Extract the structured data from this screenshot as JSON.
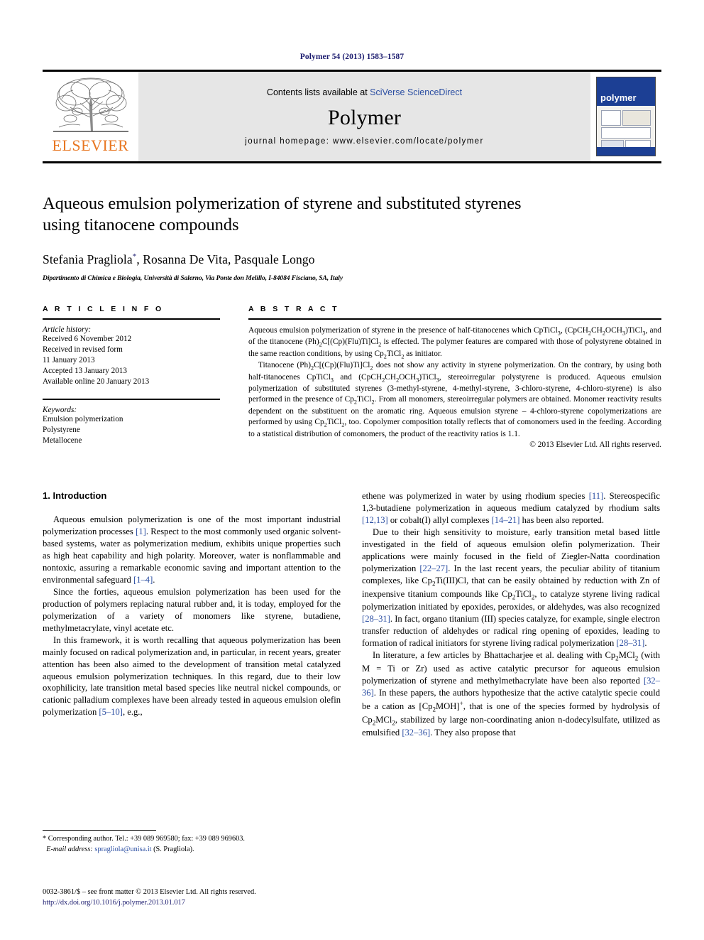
{
  "running_head": "Polymer 54 (2013) 1583–1587",
  "masthead": {
    "publisher_name": "ELSEVIER",
    "contents_prefix": "Contents lists available at ",
    "contents_link": "SciVerse ScienceDirect",
    "journal_name": "Polymer",
    "homepage": "journal homepage: www.elsevier.com/locate/polymer",
    "cover_title": "polymer"
  },
  "article": {
    "title_line1": "Aqueous emulsion polymerization of styrene and substituted styrenes",
    "title_line2": "using titanocene compounds",
    "authors": "Stefania Pragliola*, Rosanna De Vita, Pasquale Longo",
    "affiliation": "Dipartimento di Chimica e Biologia, Università di Salerno, Via Ponte don Melillo, I-84084 Fisciano, SA, Italy"
  },
  "info": {
    "heading": "A R T I C L E  I N F O",
    "history_label": "Article history:",
    "history": [
      "Received 6 November 2012",
      "Received in revised form",
      "11 January 2013",
      "Accepted 13 January 2013",
      "Available online 20 January 2013"
    ],
    "keywords_label": "Keywords:",
    "keywords": [
      "Emulsion polymerization",
      "Polystyrene",
      "Metallocene"
    ]
  },
  "abstract": {
    "heading": "A B S T R A C T",
    "paragraph1": "Aqueous emulsion polymerization of styrene in the presence of half-titanocenes which CpTiCl3, (CpCH2CH2OCH3)TiCl3, and of the titanocene (Ph)2C[(Cp)(Flu)Ti]Cl2 is effected. The polymer features are compared with those of polystyrene obtained in the same reaction conditions, by using Cp2TiCl2 as initiator.",
    "paragraph2": "Titanocene (Ph)2C[(Cp)(Flu)Ti]Cl2 does not show any activity in styrene polymerization. On the contrary, by using both half-titanocenes CpTiCl3 and (CpCH2CH2OCH3)TiCl3, stereoirregular polystyrene is produced. Aqueous emulsion polymerization of substituted styrenes (3-methyl-styrene, 4-methyl-styrene, 3-chloro-styrene, 4-chloro-styrene) is also performed in the presence of Cp2TiCl2. From all monomers, stereoirregular polymers are obtained. Monomer reactivity results dependent on the substituent on the aromatic ring. Aqueous emulsion styrene – 4-chloro-styrene copolymerizations are performed by using Cp2TiCl2, too. Copolymer composition totally reflects that of comonomers used in the feeding. According to a statistical distribution of comonomers, the product of the reactivity ratios is 1.1.",
    "copyright": "© 2013 Elsevier Ltd. All rights reserved."
  },
  "introduction": {
    "heading": "1. Introduction",
    "left_paragraphs": [
      "Aqueous emulsion polymerization is one of the most important industrial polymerization processes [1]. Respect to the most commonly used organic solvent-based systems, water as polymerization medium, exhibits unique properties such as high heat capability and high polarity. Moreover, water is nonflammable and nontoxic, assuring a remarkable economic saving and important attention to the environmental safeguard [1–4].",
      "Since the forties, aqueous emulsion polymerization has been used for the production of polymers replacing natural rubber and, it is today, employed for the polymerization of a variety of monomers like styrene, butadiene, methylmetacrylate, vinyl acetate etc.",
      "In this framework, it is worth recalling that aqueous polymerization has been mainly focused on radical polymerization and, in particular, in recent years, greater attention has been also aimed to the development of transition metal catalyzed aqueous emulsion polymerization techniques. In this regard, due to their low oxophilicity, late transition metal based species like neutral nickel compounds, or cationic palladium complexes have been already tested in aqueous emulsion olefin polymerization [5–10], e.g.,"
    ],
    "right_paragraphs": [
      "ethene was polymerized in water by using rhodium species [11]. Stereospecific 1,3-butadiene polymerization in aqueous medium catalyzed by rhodium salts [12,13] or cobalt(I) allyl complexes [14–21] has been also reported.",
      "Due to their high sensitivity to moisture, early transition metal based little investigated in the field of aqueous emulsion olefin polymerization. Their applications were mainly focused in the field of Ziegler-Natta coordination polymerization [22–27]. In the last recent years, the peculiar ability of titanium complexes, like Cp2Ti(III)Cl, that can be easily obtained by reduction with Zn of inexpensive titanium compounds like Cp2TiCl2, to catalyze styrene living radical polymerization initiated by epoxides, peroxides, or aldehydes, was also recognized [28–31]. In fact, organo titanium (III) species catalyze, for example, single electron transfer reduction of aldehydes or radical ring opening of epoxides, leading to formation of radical initiators for styrene living radical polymerization [28–31].",
      "In literature, a few articles by Bhattacharjee et al. dealing with Cp2MCl2 (with M = Ti or Zr) used as active catalytic precursor for aqueous emulsion polymerization of styrene and methylmethacrylate have been also reported [32–36]. In these papers, the authors hypothesize that the active catalytic specie could be a cation as [Cp2MOH]+, that is one of the species formed by hydrolysis of Cp2MCl2, stabilized by large non-coordinating anion n-dodecylsulfate, utilized as emulsified [32–36]. They also propose that"
    ]
  },
  "footnote": {
    "corresponding": "* Corresponding author. Tel.: +39 089 969580; fax: +39 089 969603.",
    "email_label": "E-mail address:",
    "email": "spragliola@unisa.it",
    "email_suffix": "(S. Pragliola)."
  },
  "footer": {
    "issn_line": "0032-3861/$ – see front matter © 2013 Elsevier Ltd. All rights reserved.",
    "doi": "http://dx.doi.org/10.1016/j.polymer.2013.01.017"
  },
  "colors": {
    "link_blue": "#2b4ea2",
    "header_navy": "#1a1a6e",
    "elsevier_orange": "#E87722",
    "cover_blue": "#1c3f94"
  }
}
